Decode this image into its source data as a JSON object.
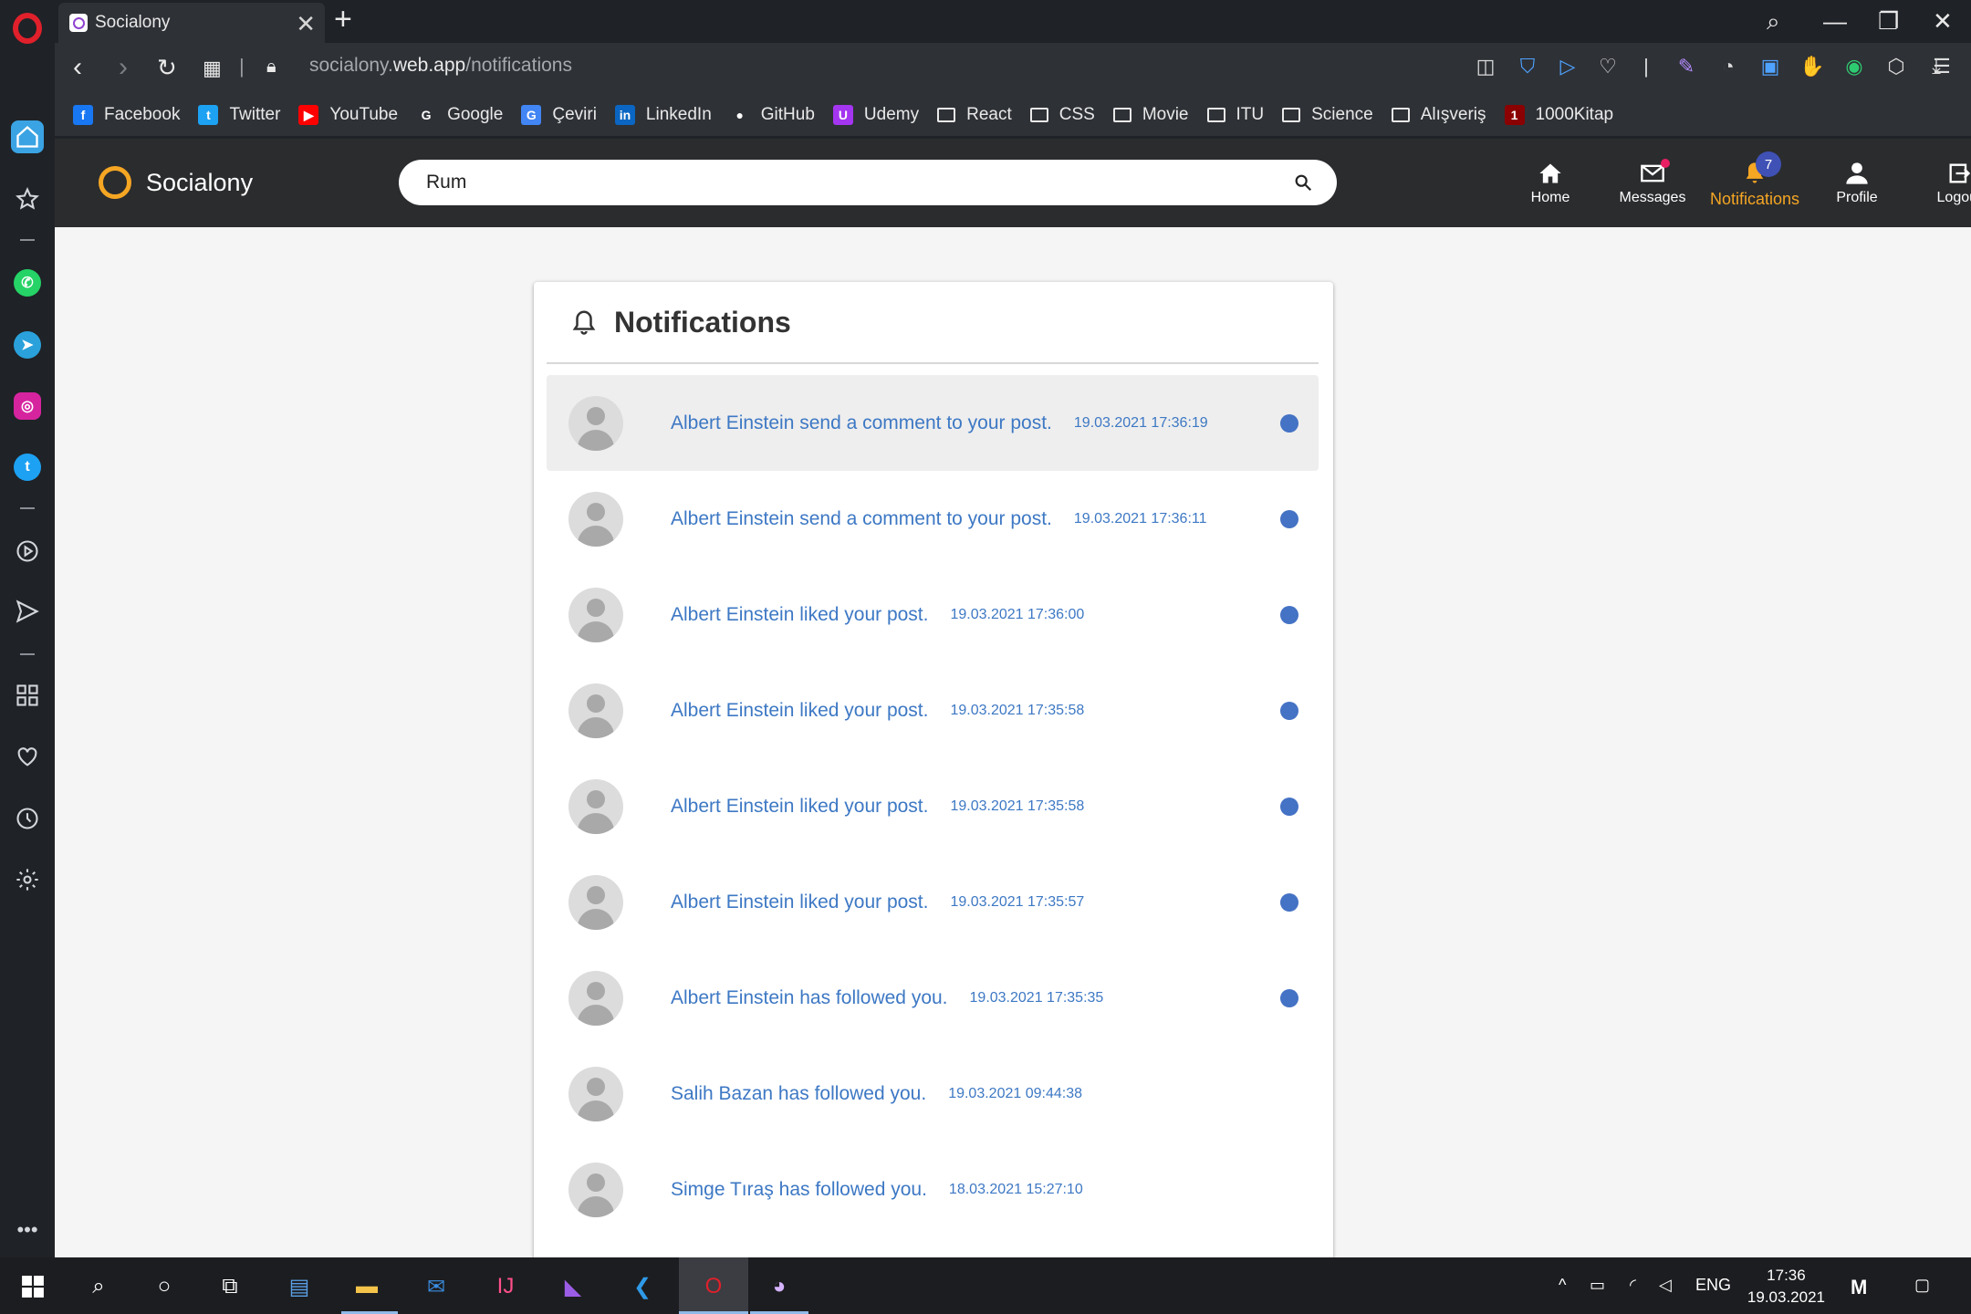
{
  "browser": {
    "tab_title": "Socialony",
    "url_prefix": "socialony.",
    "url_domain": "web.app",
    "url_path": "/notifications"
  },
  "bookmarks": [
    {
      "label": "Facebook",
      "icon": "facebook-icon",
      "color": "#1877f2",
      "glyph": "f"
    },
    {
      "label": "Twitter",
      "icon": "twitter-icon",
      "color": "#1da1f2",
      "glyph": "t"
    },
    {
      "label": "YouTube",
      "icon": "youtube-icon",
      "color": "#ff0000",
      "glyph": "▶"
    },
    {
      "label": "Google",
      "icon": "google-icon",
      "color": "#ffffff",
      "glyph": "G"
    },
    {
      "label": "Çeviri",
      "icon": "translate-icon",
      "color": "#4285f4",
      "glyph": "G"
    },
    {
      "label": "LinkedIn",
      "icon": "linkedin-icon",
      "color": "#0a66c2",
      "glyph": "in"
    },
    {
      "label": "GitHub",
      "icon": "github-icon",
      "color": "#ffffff",
      "glyph": "●"
    },
    {
      "label": "Udemy",
      "icon": "udemy-icon",
      "color": "#a435f0",
      "glyph": "U"
    },
    {
      "label": "React",
      "icon": "folder-icon"
    },
    {
      "label": "CSS",
      "icon": "folder-icon"
    },
    {
      "label": "Movie",
      "icon": "folder-icon"
    },
    {
      "label": "ITU",
      "icon": "folder-icon"
    },
    {
      "label": "Science",
      "icon": "folder-icon"
    },
    {
      "label": "Alışveriş",
      "icon": "folder-icon"
    },
    {
      "label": "1000Kitap",
      "icon": "1000kitap-icon",
      "color": "#8b0000",
      "glyph": "1"
    }
  ],
  "site": {
    "brand": "Socialony",
    "search_value": "Rum",
    "nav": [
      {
        "label": "Home",
        "icon": "home-icon"
      },
      {
        "label": "Messages",
        "icon": "mail-icon"
      },
      {
        "label": "Notifications",
        "icon": "bell-icon",
        "badge": "7"
      },
      {
        "label": "Profile",
        "icon": "person-icon"
      },
      {
        "label": "Logout",
        "icon": "logout-icon"
      }
    ],
    "accent_color": "#f5a623"
  },
  "notifications": {
    "title": "Notifications",
    "items": [
      {
        "text": "Albert Einstein send a comment to your post.",
        "time": "19.03.2021 17:36:19",
        "unread": true
      },
      {
        "text": "Albert Einstein send a comment to your post.",
        "time": "19.03.2021 17:36:11",
        "unread": true
      },
      {
        "text": "Albert Einstein liked your post.",
        "time": "19.03.2021 17:36:00",
        "unread": true
      },
      {
        "text": "Albert Einstein liked your post.",
        "time": "19.03.2021 17:35:58",
        "unread": true
      },
      {
        "text": "Albert Einstein liked your post.",
        "time": "19.03.2021 17:35:58",
        "unread": true
      },
      {
        "text": "Albert Einstein liked your post.",
        "time": "19.03.2021 17:35:57",
        "unread": true
      },
      {
        "text": "Albert Einstein has followed you.",
        "time": "19.03.2021 17:35:35",
        "unread": true
      },
      {
        "text": "Salih Bazan has followed you.",
        "time": "19.03.2021 09:44:38",
        "unread": false
      },
      {
        "text": "Simge Tıraş has followed you.",
        "time": "18.03.2021 15:27:10",
        "unread": false
      }
    ]
  },
  "taskbar": {
    "language": "ENG",
    "time": "17:36",
    "date": "19.03.2021"
  }
}
